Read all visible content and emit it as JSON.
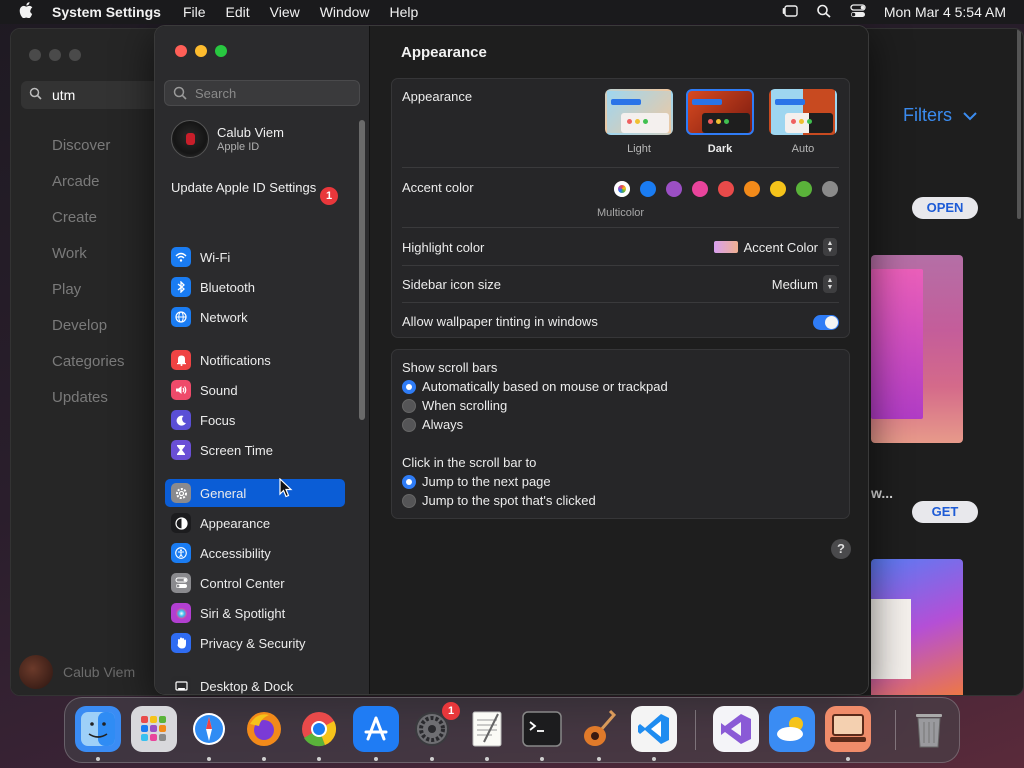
{
  "menubar": {
    "app_name": "System Settings",
    "items": [
      "File",
      "Edit",
      "View",
      "Window",
      "Help"
    ],
    "clock": "Mon Mar 4  5:54 AM"
  },
  "appstore": {
    "search_value": "utm",
    "nav": [
      "Discover",
      "Arcade",
      "Create",
      "Work",
      "Play",
      "Develop",
      "Categories",
      "Updates"
    ],
    "user_name": "Calub Viem",
    "filters_label": "Filters",
    "open_label": "OPEN",
    "get_label": "GET",
    "truncated_title": "w..."
  },
  "sidebar": {
    "search_placeholder": "Search",
    "user_name": "Calub Viem",
    "user_sub": "Apple ID",
    "update_label": "Update Apple ID Settings",
    "update_badge": "1",
    "items": [
      {
        "label": "Wi-Fi",
        "icon": "wifi-icon",
        "color": "#1a7cf2"
      },
      {
        "label": "Bluetooth",
        "icon": "bluetooth-icon",
        "color": "#1a7cf2"
      },
      {
        "label": "Network",
        "icon": "globe-icon",
        "color": "#1a7cf2"
      },
      {
        "label": "Notifications",
        "icon": "bell-icon",
        "color": "#ef4343"
      },
      {
        "label": "Sound",
        "icon": "speaker-icon",
        "color": "#ef4a6a"
      },
      {
        "label": "Focus",
        "icon": "moon-icon",
        "color": "#5a4fd6"
      },
      {
        "label": "Screen Time",
        "icon": "hourglass-icon",
        "color": "#6a4fd6"
      },
      {
        "label": "General",
        "icon": "gear-icon",
        "color": "#8a8a8e"
      },
      {
        "label": "Appearance",
        "icon": "appearance-icon",
        "color": "#1c1c1e"
      },
      {
        "label": "Accessibility",
        "icon": "accessibility-icon",
        "color": "#1a7cf2"
      },
      {
        "label": "Control Center",
        "icon": "control-center-icon",
        "color": "#8a8a8e"
      },
      {
        "label": "Siri & Spotlight",
        "icon": "siri-icon",
        "color": "#b23fd1"
      },
      {
        "label": "Privacy & Security",
        "icon": "hand-icon",
        "color": "#2f6cf2"
      },
      {
        "label": "Desktop & Dock",
        "icon": "desktop-icon",
        "color": "#2a2a2c"
      }
    ]
  },
  "content": {
    "title": "Appearance",
    "appearance_label": "Appearance",
    "appearance_options": [
      "Light",
      "Dark",
      "Auto"
    ],
    "accent_label": "Accent color",
    "accent_colors": [
      "#b06bd6",
      "#1a7cf2",
      "#9b4fc4",
      "#e9449c",
      "#e94a4a",
      "#f28a1a",
      "#f5c31a",
      "#5ab33a",
      "#8a8a8a"
    ],
    "multicolor_label": "Multicolor",
    "highlight_label": "Highlight color",
    "highlight_value": "Accent Color",
    "sidebar_size_label": "Sidebar icon size",
    "sidebar_size_value": "Medium",
    "tinting_label": "Allow wallpaper tinting in windows",
    "scrollbars_label": "Show scroll bars",
    "scrollbar_options": [
      "Automatically based on mouse or trackpad",
      "When scrolling",
      "Always"
    ],
    "click_label": "Click in the scroll bar to",
    "click_options": [
      "Jump to the next page",
      "Jump to the spot that's clicked"
    ],
    "help": "?"
  },
  "dock": {
    "apps": [
      {
        "name": "finder-icon",
        "color": "#3a8cf4"
      },
      {
        "name": "launchpad-icon",
        "color": "#d8d8dc"
      },
      {
        "name": "safari-icon",
        "color": "#2f8cf4"
      },
      {
        "name": "firefox-icon",
        "color": "#e8542a"
      },
      {
        "name": "chrome-icon",
        "color": "#f4f4f4"
      },
      {
        "name": "app-store-icon",
        "color": "#1f7cf4"
      },
      {
        "name": "system-settings-icon",
        "color": "#8a8a8e"
      },
      {
        "name": "textedit-icon",
        "color": "#f4f4f0"
      },
      {
        "name": "terminal-icon",
        "color": "#1c1c1e"
      },
      {
        "name": "garageband-icon",
        "color": "#3a2a20"
      },
      {
        "name": "vscode-icon",
        "color": "#f4f4f4"
      },
      {
        "name": "visual-studio-icon",
        "color": "#f4f4f8"
      },
      {
        "name": "weather-icon",
        "color": "#3a8cf4"
      },
      {
        "name": "utm-icon",
        "color": "#f08c6a"
      },
      {
        "name": "trash-icon",
        "color": "#5a5a5e"
      }
    ],
    "settings_badge": "1"
  }
}
